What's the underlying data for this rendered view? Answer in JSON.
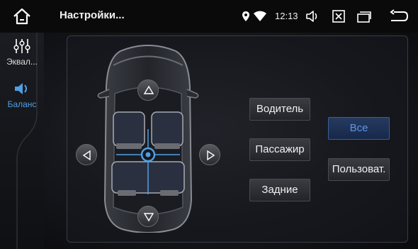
{
  "header": {
    "title": "Настройки...",
    "time": "12:13",
    "icons": [
      "home-icon",
      "location-icon",
      "wifi-icon",
      "volume-icon",
      "close-box-icon",
      "recent-apps-icon",
      "back-icon"
    ]
  },
  "sidebar": {
    "items": [
      {
        "label": "Эквал...",
        "icon": "equalizer-icon",
        "active": false
      },
      {
        "label": "Баланс",
        "icon": "speaker-icon",
        "active": true
      }
    ]
  },
  "balance": {
    "zones": {
      "driver": "Водитель",
      "passenger": "Пассажир",
      "rear": "Задние",
      "all": "Все",
      "custom": "Пользоват."
    },
    "selected_zone": "all",
    "arrows": [
      "up",
      "down",
      "left",
      "right"
    ]
  },
  "colors": {
    "accent": "#4f9fe4",
    "selected_text": "#5e96e4",
    "background": "#16171c"
  }
}
